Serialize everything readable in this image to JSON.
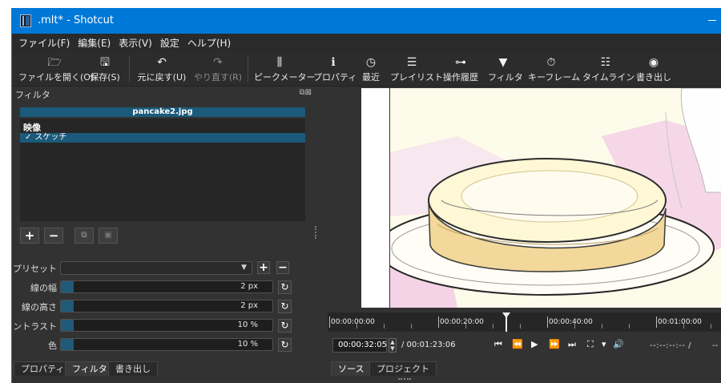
{
  "window": {
    "title": ".mlt* - Shotcut"
  },
  "menu": [
    "ファイル(F)",
    "編集(E)",
    "表示(V)",
    "設定",
    "ヘルプ(H)"
  ],
  "toolbar": [
    {
      "label": "ファイルを開く(O)",
      "icon": "folder-open-icon",
      "glyph": "🗁",
      "enabled": true
    },
    {
      "label": "保存(S)",
      "icon": "save-icon",
      "glyph": "🖫",
      "enabled": true
    },
    {
      "label": "元に戻す(U)",
      "icon": "undo-icon",
      "glyph": "↶",
      "enabled": true
    },
    {
      "label": "やり直す(R)",
      "icon": "redo-icon",
      "glyph": "↷",
      "enabled": false
    },
    {
      "label": "ピークメーター",
      "icon": "peak-meter-icon",
      "glyph": "⫼",
      "enabled": true
    },
    {
      "label": "プロパティ",
      "icon": "info-icon",
      "glyph": "ℹ",
      "enabled": true
    },
    {
      "label": "最近",
      "icon": "clock-icon",
      "glyph": "◷",
      "enabled": true
    },
    {
      "label": "プレイリスト",
      "icon": "playlist-icon",
      "glyph": "☰",
      "enabled": true
    },
    {
      "label": "操作履歴",
      "icon": "history-icon",
      "glyph": "⊶",
      "enabled": true
    },
    {
      "label": "フィルタ",
      "icon": "filter-icon",
      "glyph": "▼",
      "enabled": true
    },
    {
      "label": "キーフレーム",
      "icon": "stopwatch-icon",
      "glyph": "⏱",
      "enabled": true
    },
    {
      "label": "タイムライン",
      "icon": "timeline-icon",
      "glyph": "☷",
      "enabled": true
    },
    {
      "label": "書き出し",
      "icon": "export-disc-icon",
      "glyph": "◉",
      "enabled": true
    }
  ],
  "filters_panel": {
    "title": "フィルタ",
    "clip_name": "pancake2.jpg",
    "category": "映像",
    "items": [
      {
        "checked": true,
        "check_glyph": "✓",
        "name": "スケッチ"
      }
    ],
    "buttons": [
      {
        "name": "add-filter-button",
        "glyph": "+"
      },
      {
        "name": "remove-filter-button",
        "glyph": "−"
      },
      {
        "name": "copy-filter-button",
        "glyph": "⧉"
      },
      {
        "name": "paste-filter-button",
        "glyph": "▣"
      }
    ],
    "preset": {
      "label": "プリセット",
      "value": ""
    },
    "params": [
      {
        "label": "線の幅",
        "value": "2 px",
        "level": 0.06
      },
      {
        "label": "線の高さ",
        "value": "2 px",
        "level": 0.06
      },
      {
        "label": "コントラスト",
        "value": "10 %",
        "level": 0.06
      },
      {
        "label": "色",
        "value": "10 %",
        "level": 0.06
      }
    ],
    "reset_glyph": "↻",
    "tabs": [
      "プロパティ",
      "フィルタ",
      "書き出し"
    ],
    "active_tab": 1
  },
  "player": {
    "ruler_labels": [
      "00:00:00:00",
      "00:00:20:00",
      "00:00:40:00",
      "00:01:00:00"
    ],
    "position": "00:00:32:05",
    "duration": "/ 00:01:23:06",
    "in_point": "--:--:--:-- /",
    "out_point": "--",
    "controls": [
      {
        "name": "skip-to-start-button",
        "glyph": "⏮"
      },
      {
        "name": "rewind-button",
        "glyph": "⏪"
      },
      {
        "name": "play-button",
        "glyph": "▶"
      },
      {
        "name": "fast-forward-button",
        "glyph": "⏩"
      },
      {
        "name": "skip-to-end-button",
        "glyph": "⏭"
      },
      {
        "name": "zoom-button",
        "glyph": "⛶"
      },
      {
        "name": "zoom-dropdown",
        "glyph": "▾"
      },
      {
        "name": "volume-button",
        "glyph": "🔊"
      }
    ],
    "tabs": [
      "ソース",
      "プロジェクト"
    ]
  },
  "colors": {
    "titlebar": "#0078d7",
    "accent": "#1b5a7a",
    "panel": "#323232"
  }
}
